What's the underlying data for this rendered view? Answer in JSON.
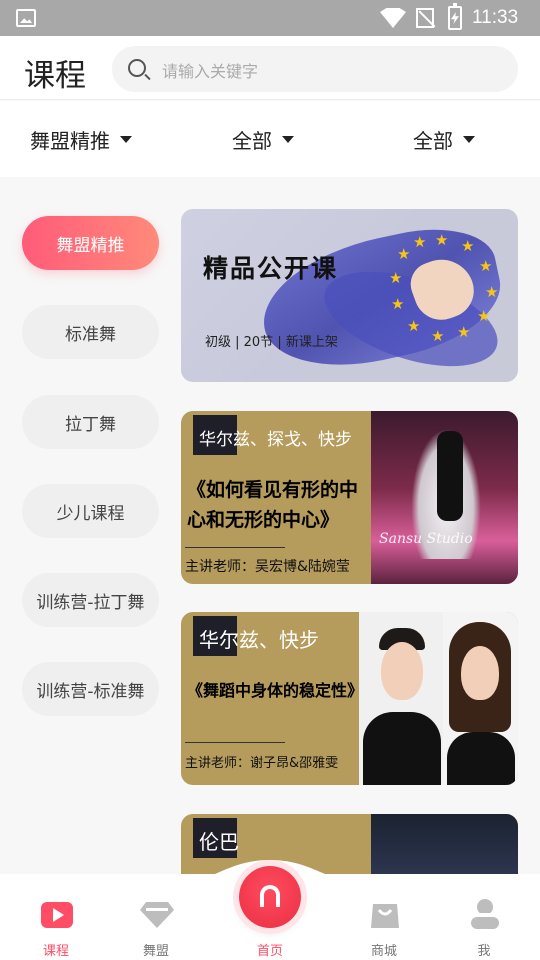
{
  "status_bar": {
    "time": "11:33"
  },
  "header": {
    "title": "课程",
    "search_placeholder": "请输入关键字"
  },
  "filters": [
    {
      "label": "舞盟精推"
    },
    {
      "label": "全部"
    },
    {
      "label": "全部"
    }
  ],
  "categories": [
    {
      "label": "舞盟精推",
      "active": true
    },
    {
      "label": "标准舞"
    },
    {
      "label": "拉丁舞"
    },
    {
      "label": "少儿课程"
    },
    {
      "label": "训练营-拉丁舞"
    },
    {
      "label": "训练营-标准舞"
    }
  ],
  "cards": [
    {
      "title": "精品公开课",
      "info": "初级 | 20节 | 新课上架"
    },
    {
      "tag": "华尔兹、探戈、快步",
      "lesson_line1": "《如何看见有形的中",
      "lesson_line2": "心和无形的中心》",
      "teacher": "主讲老师：吴宏博&陆婉莹",
      "photo_caption": "Sansu Studio"
    },
    {
      "tag": "华尔兹、快步",
      "lesson_line1": "《舞蹈中身体的稳定性》",
      "teacher": "主讲老师：谢子昂&邵雅雯"
    },
    {
      "tag": "伦巴"
    }
  ],
  "bottom_nav": [
    {
      "label": "课程",
      "icon": "course-play-icon",
      "active": true
    },
    {
      "label": "舞盟",
      "icon": "diamond-icon"
    },
    {
      "label": "首页",
      "icon": "home-icon"
    },
    {
      "label": "商城",
      "icon": "shopping-bag-icon"
    },
    {
      "label": "我",
      "icon": "profile-icon"
    }
  ],
  "colors": {
    "accent": "#ff4d66",
    "card_gold": "#b59b5c"
  }
}
